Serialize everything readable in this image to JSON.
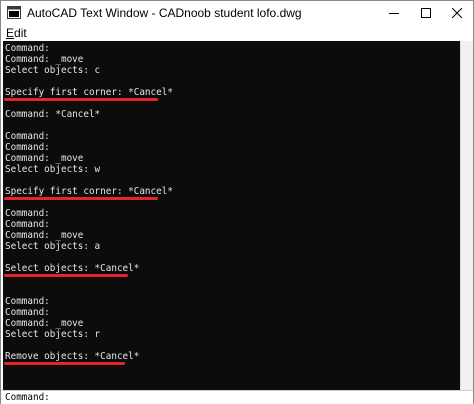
{
  "window": {
    "title": "AutoCAD Text Window - CADnoob student lofo.dwg"
  },
  "menu": {
    "edit_prefix": "E",
    "edit_rest": "dit"
  },
  "console": {
    "lines": [
      "Command:",
      "Command: _move",
      "Select objects: c",
      "",
      "Specify first corner: *Cancel*",
      "",
      "Command: *Cancel*",
      "",
      "Command:",
      "Command:",
      "Command: _move",
      "Select objects: w",
      "",
      "Specify first corner: *Cancel*",
      "Command:",
      "Command:",
      "Command: _move",
      "Select objects: a",
      "",
      "Select objects: *Cancel*",
      "Command:",
      "Command:",
      "Command: _move",
      "Select objects: r",
      "",
      "Remove objects: *Cancel*"
    ]
  },
  "command_line": {
    "label": "Command:",
    "value": ""
  },
  "colors": {
    "console_bg": "#0c0c0c",
    "console_text": "#e6e6e6",
    "highlight_underline": "#e8242a"
  }
}
